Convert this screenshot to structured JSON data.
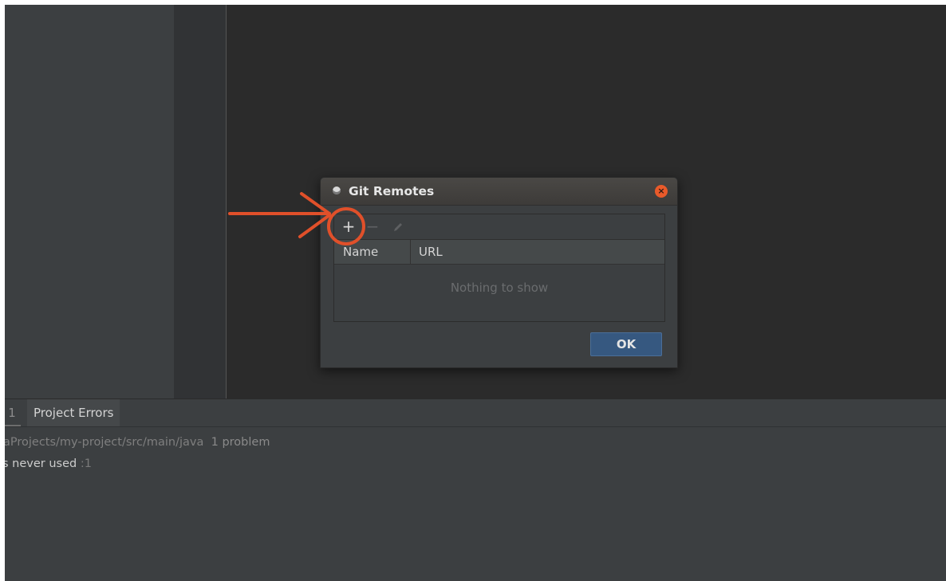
{
  "bottom_panel": {
    "tab_number": "1",
    "tab_label": "Project Errors",
    "problem_path": "aProjects/my-project/src/main/java",
    "problem_count": "1 problem",
    "problem_text": "s never used",
    "problem_line": ":1"
  },
  "dialog": {
    "title": "Git Remotes",
    "toolbar": {
      "add_icon": "plus-icon",
      "remove_icon": "minus-icon",
      "edit_icon": "pencil-icon"
    },
    "columns": [
      "Name",
      "URL"
    ],
    "empty_text": "Nothing to show",
    "ok_label": "OK"
  },
  "colors": {
    "accent_annotation": "#e0502a",
    "ok_button": "#365880",
    "close_button": "#e95a2a"
  }
}
